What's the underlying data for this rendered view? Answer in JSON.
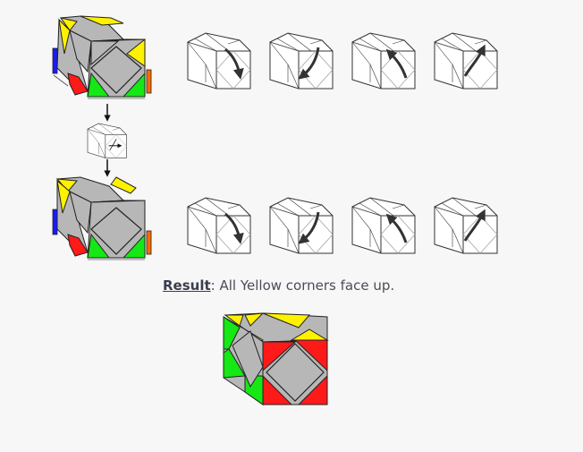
{
  "caption": {
    "label": "Result",
    "text": ": All Yellow corners face up."
  },
  "colors": {
    "background": "#f7f7f7",
    "yellow": "#fff200",
    "gray": "#b7b7b7",
    "red": "#ff1a1a",
    "green": "#15e815",
    "blue": "#1a1aff",
    "orange": "#ff6a00",
    "outline": "#222222",
    "arrow": "#333333"
  },
  "icons": {
    "move_arrow": "curved-arrow-icon",
    "down_arrow": "arrow-down-icon"
  },
  "move_rows": [
    {
      "label": "top",
      "moves": [
        "right-face-down",
        "right-face-down-left",
        "right-face-up-left",
        "right-face-up-right"
      ]
    },
    {
      "label": "bottom",
      "moves": [
        "right-face-down",
        "right-face-down-left",
        "right-face-up-left",
        "right-face-up-right"
      ]
    }
  ]
}
